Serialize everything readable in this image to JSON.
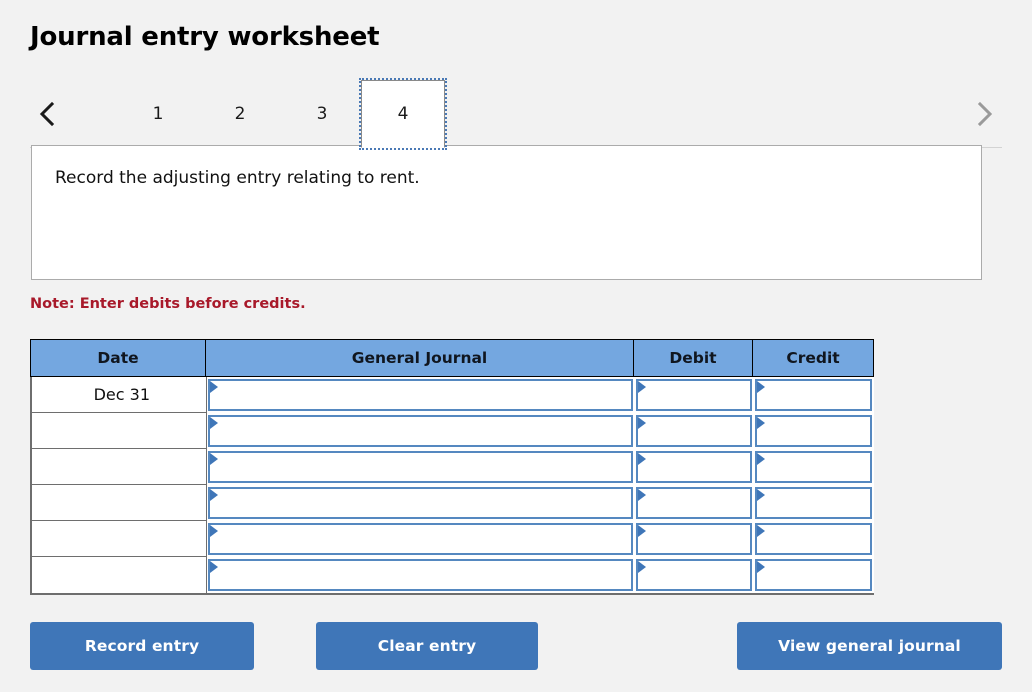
{
  "page": {
    "title": "Journal entry worksheet",
    "background_color": "#f2f2f2"
  },
  "tabstrip": {
    "prev_icon": "chevron-left-icon",
    "next_icon": "chevron-right-icon",
    "prev_enabled_color": "#1a1a1a",
    "next_enabled_color": "#9a9a9a",
    "selected_index": 3,
    "tabs": [
      {
        "label": "1"
      },
      {
        "label": "2"
      },
      {
        "label": "3"
      },
      {
        "label": "4"
      }
    ]
  },
  "instruction": {
    "text": "Record the adjusting entry relating to rent."
  },
  "note": {
    "text": "Note: Enter debits before credits.",
    "color": "#a8192a"
  },
  "journal": {
    "header_color": "#74a7e0",
    "columns": [
      {
        "key": "date",
        "label": "Date"
      },
      {
        "key": "general",
        "label": "General Journal"
      },
      {
        "key": "debit",
        "label": "Debit"
      },
      {
        "key": "credit",
        "label": "Credit"
      }
    ],
    "rows": [
      {
        "date": "Dec 31",
        "general": "",
        "debit": "",
        "credit": ""
      },
      {
        "date": "",
        "general": "",
        "debit": "",
        "credit": ""
      },
      {
        "date": "",
        "general": "",
        "debit": "",
        "credit": ""
      },
      {
        "date": "",
        "general": "",
        "debit": "",
        "credit": ""
      },
      {
        "date": "",
        "general": "",
        "debit": "",
        "credit": ""
      },
      {
        "date": "",
        "general": "",
        "debit": "",
        "credit": ""
      }
    ]
  },
  "buttons": {
    "color": "#3f76b8",
    "record_entry": "Record entry",
    "clear_entry": "Clear entry",
    "view_general_journal": "View general journal"
  }
}
